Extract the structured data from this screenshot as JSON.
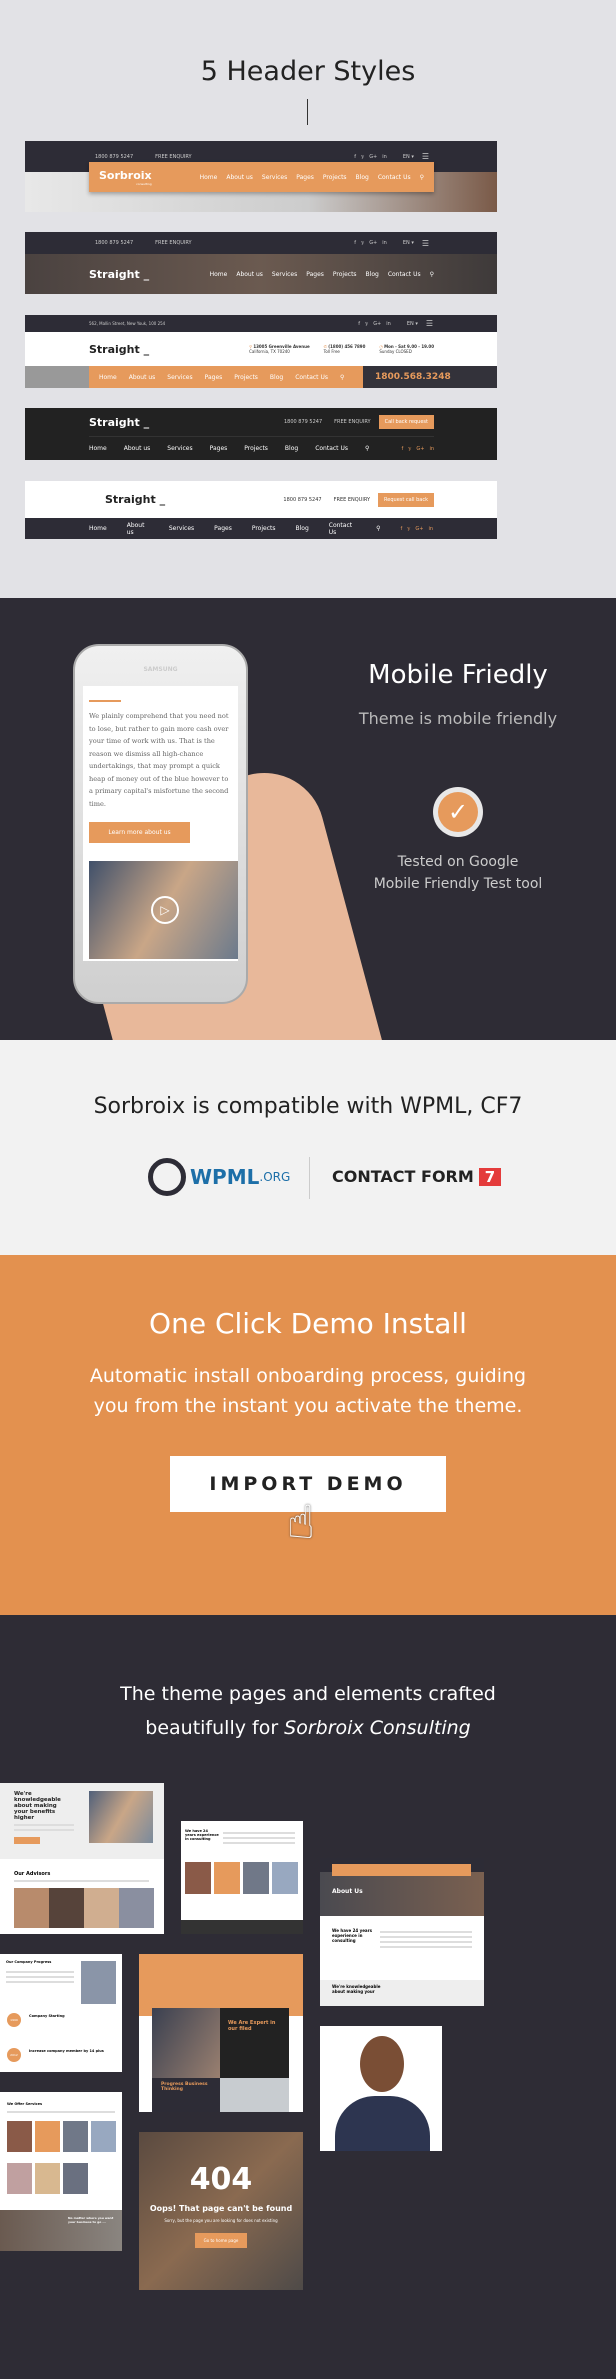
{
  "headers": {
    "title": "5 Header Styles",
    "phone": "1800 879 5247",
    "enquiry": "FREE ENQUIRY",
    "lang": "EN ▾",
    "social": [
      "f",
      "𝕪",
      "G+",
      "in"
    ],
    "nav": [
      "Home",
      "About us",
      "Services",
      "Pages",
      "Projects",
      "Blog",
      "Contact Us"
    ],
    "logo1": "Sorbroix",
    "logo1_sub": "consulting",
    "logo2": "Straight _",
    "address": "562, Mallin Street, New Youk, 100 254",
    "info": [
      {
        "l1": "13005 Greenville Avenue",
        "l2": "California, TX 70240"
      },
      {
        "l1": "(1800) 456 7890",
        "l2": "Toll Free"
      },
      {
        "l1": "Mon - Sat 9.00 - 19.00",
        "l2": "Sunday CLOSED"
      }
    ],
    "big_phone": "1800.568.3248",
    "callback": "Call back request",
    "request": "Request call back"
  },
  "mobile": {
    "title": "Mobile Friedly",
    "subtitle": "Theme is mobile friendly",
    "tested": "Tested on Google",
    "tested2": "Mobile Friendly Test tool",
    "brand": "SAMSUNG",
    "text": "We plainly comprehend that you need not to lose, but rather to gain more cash over your time of work with us. That is the reason we dismiss all high-chance undertakings, that may prompt a quick heap of money out of the blue however to a primary capital's misfortune the second time.",
    "button": "Learn more about us"
  },
  "compat": {
    "title": "Sorbroix is compatible with WPML, CF7",
    "wpml": "WPML",
    "wpml_org": ".ORG",
    "cf": "CONTACT FORM",
    "cf_num": "7"
  },
  "demo": {
    "title": "One Click Demo Install",
    "line1": "Automatic install onboarding process, guiding",
    "line2": "you from the instant you activate the theme.",
    "button": "IMPORT DEMO"
  },
  "pages": {
    "line1": "The theme pages and elements crafted",
    "line2a": "beautifully for ",
    "line2b": "Sorbroix Consulting",
    "t1_title": "We're knowledgeable about making your benefits higher",
    "t1_adv": "Our Advisors",
    "t2_title": "We have 24 years experience in consulting",
    "t3_title": "About Us",
    "t3_h": "We have 24 years experience in consulting",
    "t3_k": "We're knowledgeable about making your",
    "t4_title": "Our Company Progress",
    "t4_y1": "1999",
    "t4_a": "Company Starting",
    "t4_y2": "2012",
    "t4_b": "Increase company member by 14 plus",
    "t5_title": "We Are Expert in our filed",
    "t5_b": "Progress Business Thinking",
    "t7_title": "We Offer Services",
    "t7_cta": "No matter where you want your business to go ...",
    "e404": "404",
    "e404_title": "Oops! That page can't be found",
    "e404_sub": "Sorry, but the page you are looking for does not existing",
    "e404_btn": "Go to home page"
  },
  "colors": {
    "accent": "#e69a5c",
    "dark": "#2e2c35",
    "light": "#e2e2e6"
  }
}
